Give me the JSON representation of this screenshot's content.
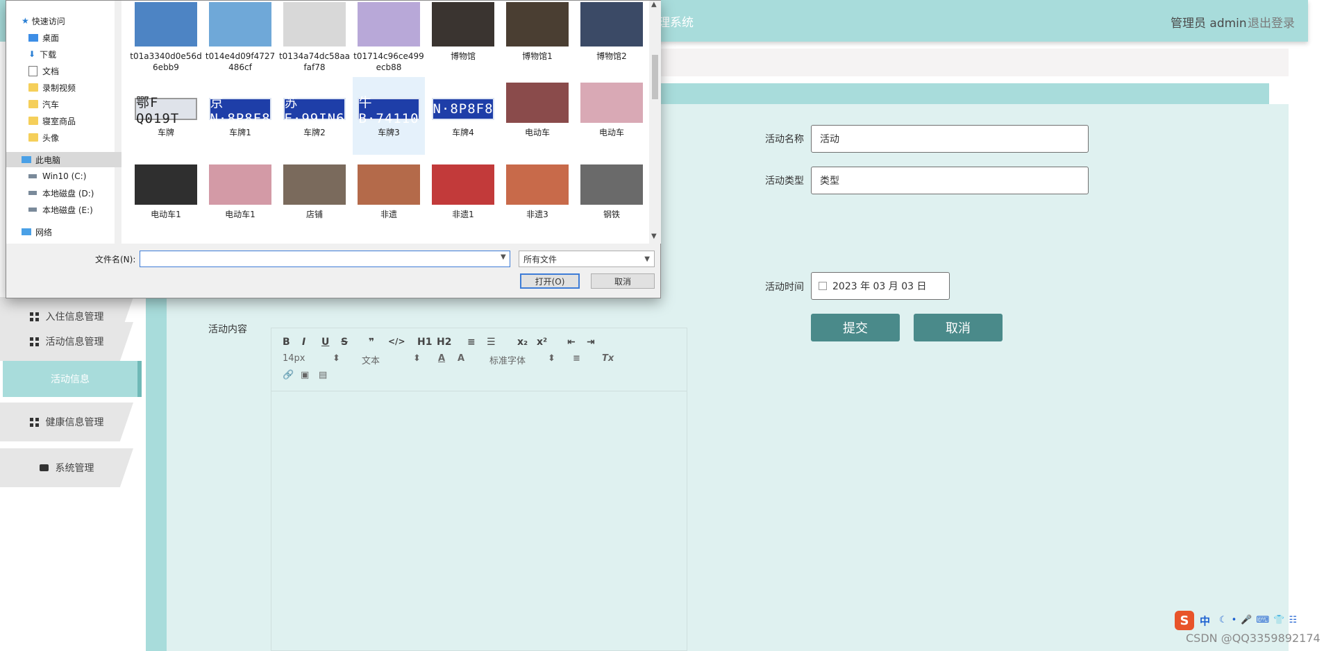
{
  "app": {
    "title_partial": "理系统",
    "user_label": "管理员 admin",
    "logout": "退出登录"
  },
  "sidebar": {
    "items": [
      {
        "label": "入住信息管理"
      },
      {
        "label": "活动信息管理"
      },
      {
        "label": "活动信息"
      },
      {
        "label": "健康信息管理"
      },
      {
        "label": "系统管理"
      }
    ]
  },
  "form": {
    "name_label": "活动名称",
    "name_value": "活动",
    "type_label": "活动类型",
    "type_value": "类型",
    "time_label": "活动时间",
    "time_value": "2023 年 03 月 03 日",
    "content_label": "活动内容",
    "submit": "提交",
    "cancel": "取消"
  },
  "editor": {
    "bold": "B",
    "italic": "I",
    "underline": "U",
    "strike": "S",
    "quote": "❞",
    "code": "</>",
    "h1": "H1",
    "h2": "H2",
    "ol": "≡",
    "ul": "☰",
    "sub": "x₂",
    "sup": "x²",
    "outdent": "⇤",
    "indent": "⇥",
    "size": "14px",
    "block": "文本",
    "font_color": "A",
    "bg_color": "A",
    "font": "标准字体",
    "align": "≡",
    "clear": "Tx",
    "link_icon": "link-icon",
    "image_icon": "image-icon",
    "video_icon": "video-icon"
  },
  "dialog": {
    "nav": [
      {
        "label": "快速访问"
      },
      {
        "label": "桌面"
      },
      {
        "label": "下载"
      },
      {
        "label": "文档"
      },
      {
        "label": "录制视频"
      },
      {
        "label": "汽车"
      },
      {
        "label": "寝室商品"
      },
      {
        "label": "头像"
      },
      {
        "label": "此电脑"
      },
      {
        "label": "Win10 (C:)"
      },
      {
        "label": "本地磁盘 (D:)"
      },
      {
        "label": "本地磁盘 (E:)"
      },
      {
        "label": "网络"
      }
    ],
    "files": [
      {
        "name": "t01a3340d0e56d6ebb9",
        "color": "#4d84c4"
      },
      {
        "name": "t014e4d09f4727486cf",
        "color": "#6fa8d8"
      },
      {
        "name": "t0134a74dc58aafaf78",
        "color": "#d8d8d8"
      },
      {
        "name": "t01714c96ce499ecb88",
        "color": "#b8a8d8"
      },
      {
        "name": "博物馆",
        "color": "#3a3430"
      },
      {
        "name": "博物馆1",
        "color": "#4a3e32"
      },
      {
        "name": "博物馆2",
        "color": "#3b4a66"
      },
      {
        "name": "车牌",
        "plate": "鄂F Q019T",
        "light": true
      },
      {
        "name": "车牌1",
        "plate": "京N·8P8F8"
      },
      {
        "name": "车牌2",
        "plate": "苏E·99IN6"
      },
      {
        "name": "车牌3",
        "plate": "牛B·74110"
      },
      {
        "name": "车牌4",
        "plate": "N·8P8F8"
      },
      {
        "name": "电动车",
        "color": "#8a4b4b"
      },
      {
        "name": "电动车",
        "color": "#d9a9b5"
      },
      {
        "name": "电动车1",
        "color": "#2f2f2f"
      },
      {
        "name": "电动车1",
        "color": "#d39aa6"
      },
      {
        "name": "店铺",
        "color": "#7a6a5c"
      },
      {
        "name": "非遗",
        "color": "#b46a4a"
      },
      {
        "name": "非遗1",
        "color": "#c23a3a"
      },
      {
        "name": "非遗3",
        "color": "#c86a4a"
      },
      {
        "name": "钢铁",
        "color": "#6a6a6a"
      }
    ],
    "filename_label": "文件名(N):",
    "filename_value": "",
    "filter": "所有文件",
    "open": "打开(O)",
    "cancel": "取消"
  },
  "taskbar": {
    "ime": "中",
    "watermark": "CSDN @QQ3359892174"
  }
}
